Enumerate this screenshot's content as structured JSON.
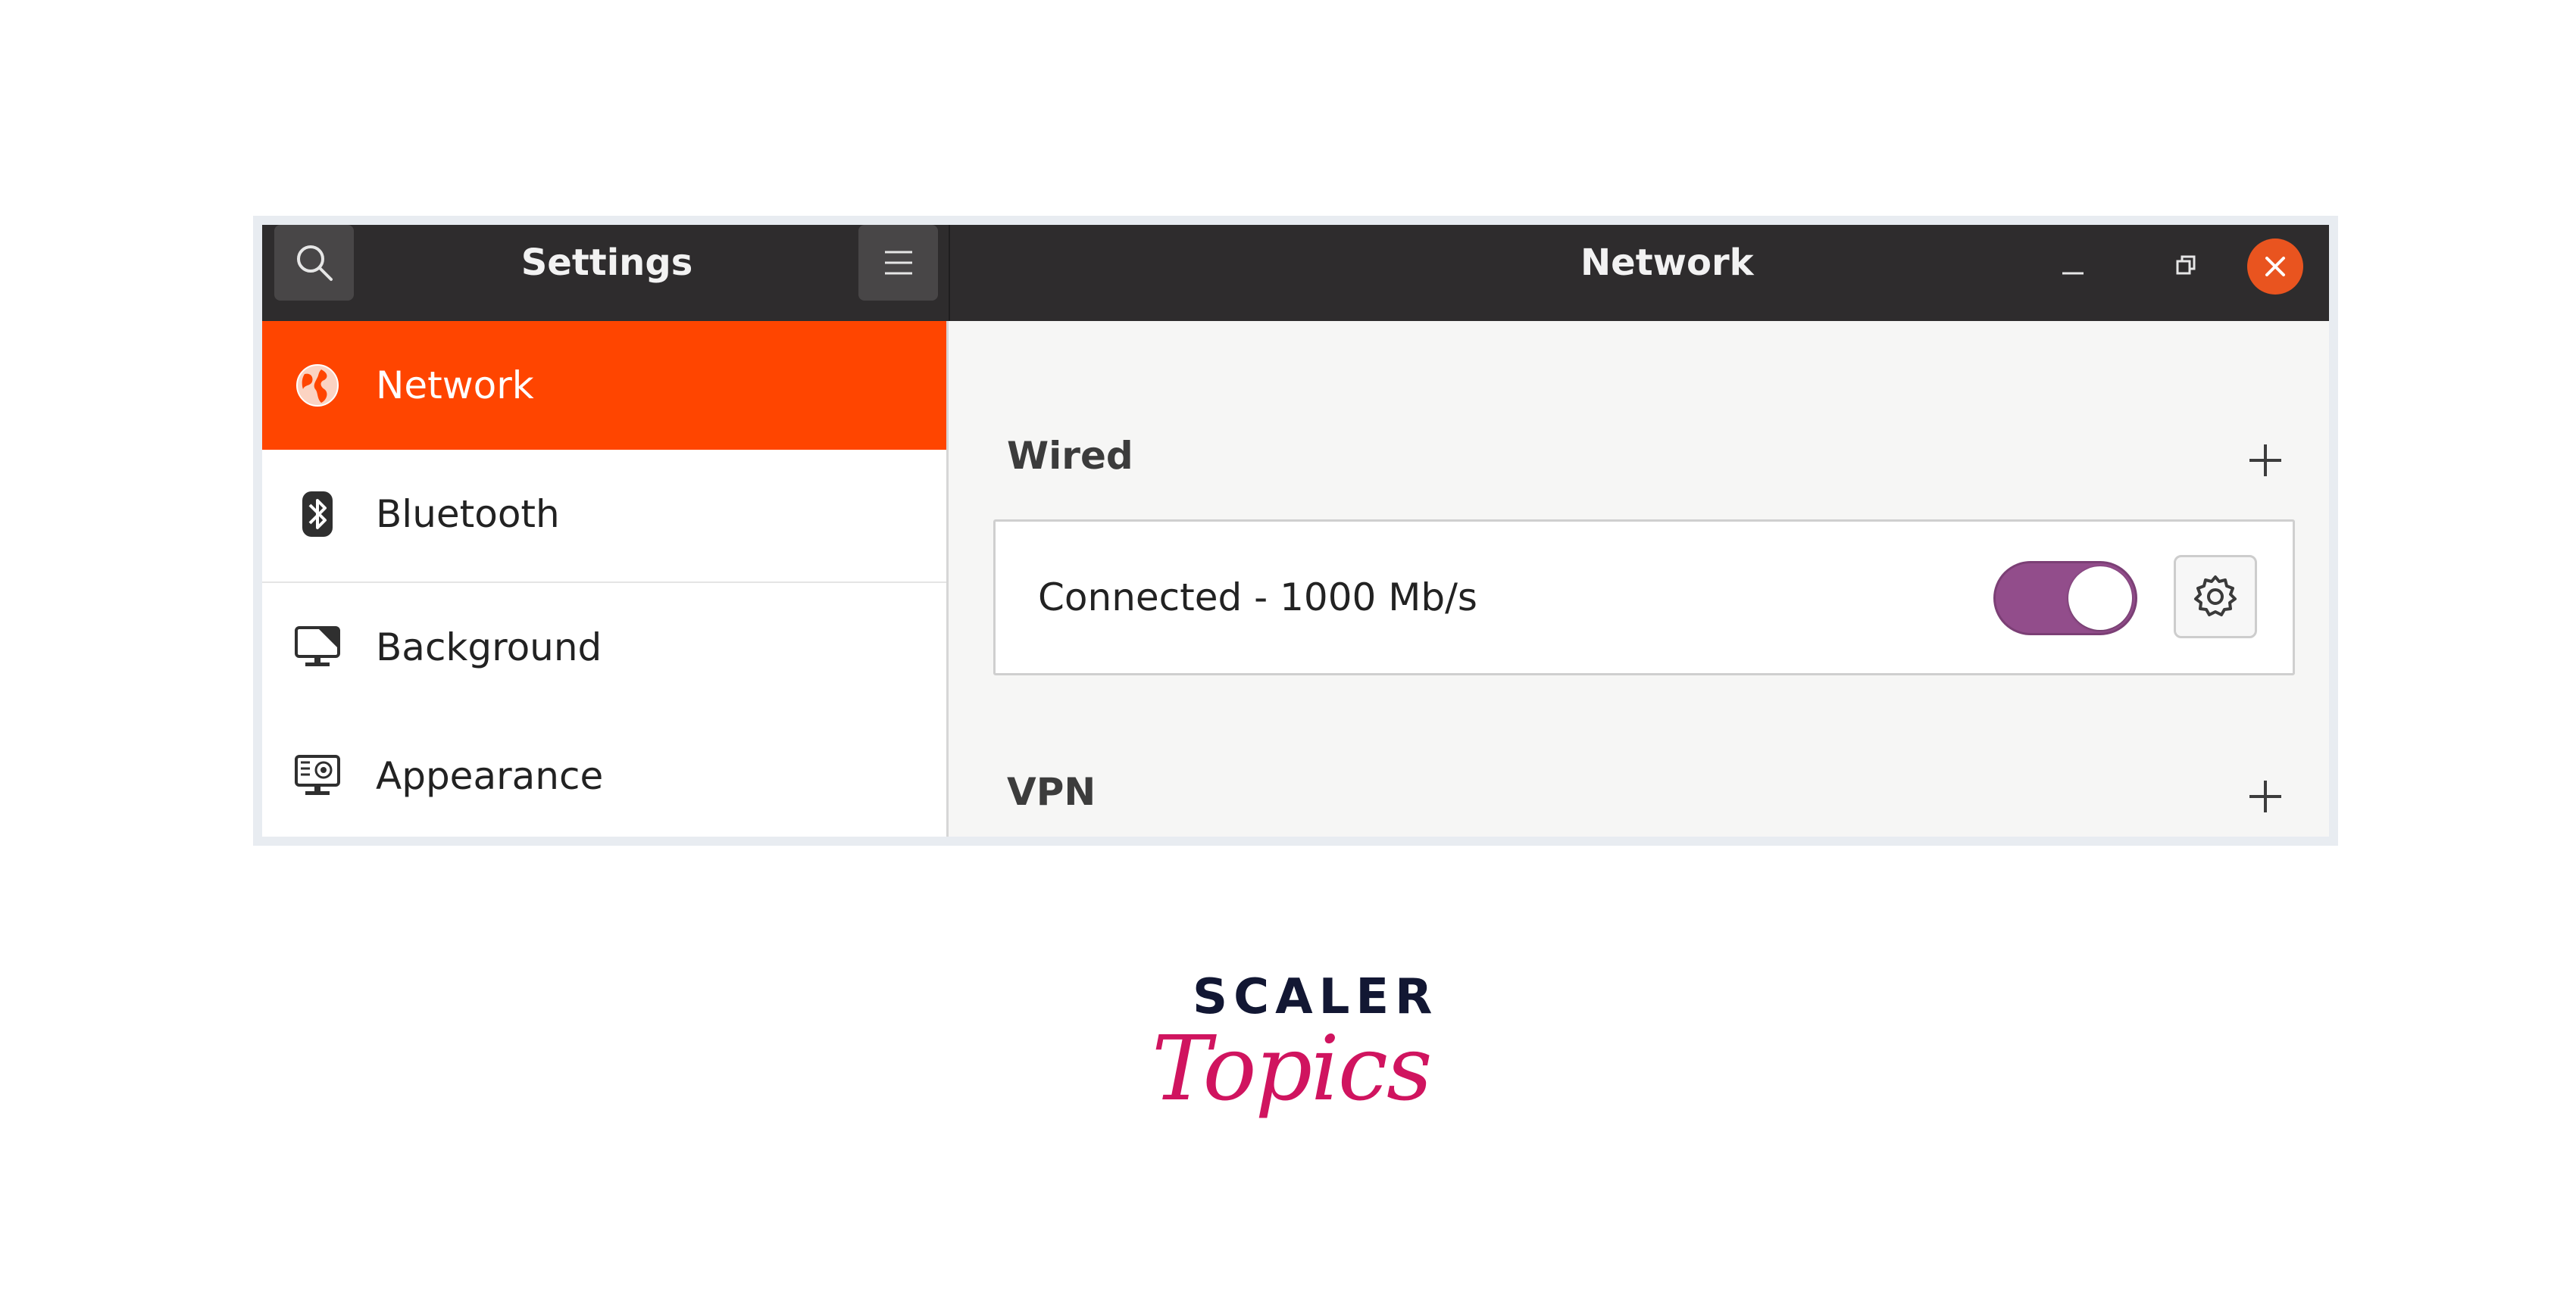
{
  "header": {
    "left_title": "Settings",
    "right_title": "Network"
  },
  "icons": {
    "search": "search-icon",
    "menu": "hamburger-menu-icon",
    "minimize": "minimize-icon",
    "restore": "restore-icon",
    "close": "close-icon",
    "network": "globe-icon",
    "bluetooth": "bluetooth-icon",
    "background": "monitor-icon",
    "appearance": "appearance-icon",
    "add": "plus-icon",
    "settings": "gear-icon"
  },
  "sidebar": {
    "items": [
      {
        "label": "Network",
        "active": true
      },
      {
        "label": "Bluetooth",
        "active": false
      },
      {
        "label": "Background",
        "active": false
      },
      {
        "label": "Appearance",
        "active": false
      }
    ]
  },
  "main": {
    "wired": {
      "title": "Wired",
      "connection_label": "Connected - 1000 Mb/s",
      "toggle_on": true
    },
    "vpn": {
      "title": "VPN"
    }
  },
  "brand": {
    "line1": "SCALER",
    "line2": "Topics"
  },
  "colors": {
    "accent_orange": "#ff4500",
    "close_orange": "#e9541f",
    "toggle_purple": "#924d8b",
    "headerbar": "#2e2c2d",
    "brand_navy": "#121733",
    "brand_pink": "#d0145f"
  }
}
